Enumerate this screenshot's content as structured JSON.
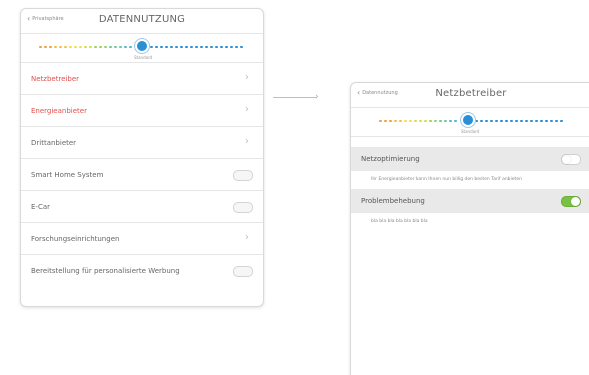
{
  "left": {
    "back_label": "Privatsphäre",
    "title": "DATENNUTZUNG",
    "slider_label": "Standard",
    "rows": [
      {
        "label": "Netzbetreiber",
        "style": "red",
        "control": "arrow"
      },
      {
        "label": "Energieanbieter",
        "style": "red",
        "control": "arrow"
      },
      {
        "label": "Drittanbieter",
        "style": "normal",
        "control": "arrow"
      },
      {
        "label": "Smart Home System",
        "style": "normal",
        "control": "toggle"
      },
      {
        "label": "E-Car",
        "style": "normal",
        "control": "toggle"
      },
      {
        "label": "Forschungseinrichtungen",
        "style": "normal",
        "control": "arrow"
      },
      {
        "label": "Bereitstellung für personalisierte Werbung",
        "style": "normal",
        "control": "toggle"
      }
    ]
  },
  "right": {
    "back_label": "Datennutzung",
    "title": "Netzbetreiber",
    "slider_label": "Standard",
    "settings": [
      {
        "label": "Netzoptimierung",
        "enabled": false,
        "description": "Ihr Energieanbieter kann Ihnen nun billig den besten Tarif anbieten"
      },
      {
        "label": "Problembehebung",
        "enabled": true,
        "description": "bla bla bla bla bla bla bla"
      }
    ]
  },
  "colors": {
    "accent_blue": "#2b8fd6",
    "red_text": "#e05050",
    "toggle_on": "#79c143",
    "dot_gradient_left": [
      "#f0a040",
      "#f4c040",
      "#f6dc50",
      "#cfe050",
      "#9fd060",
      "#70c8a0",
      "#50b8d8"
    ],
    "dot_right": "#2b8fd6"
  },
  "icons": {
    "back": "chevron-left-icon",
    "row_arrow": "chevron-right-icon",
    "connector": "arrow-right-icon"
  }
}
